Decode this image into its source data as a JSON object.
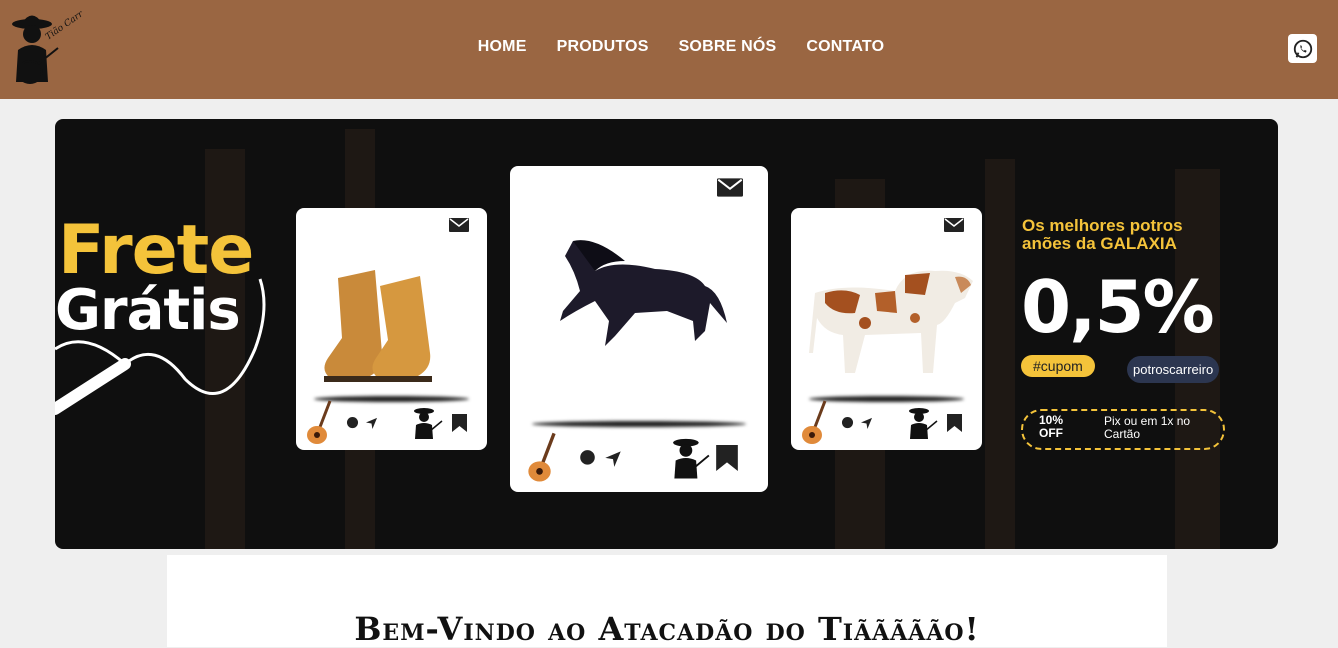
{
  "nav": {
    "items": [
      {
        "label": "HOME"
      },
      {
        "label": "PRODUTOS"
      },
      {
        "label": "SOBRE NÓS"
      },
      {
        "label": "CONTATO"
      }
    ]
  },
  "header": {
    "logo_text": "Tião Carreiro",
    "whatsapp_icon": "whatsapp-icon"
  },
  "banner": {
    "frete": "Frete",
    "gratis": "Grátis",
    "promo_title_1": "Os melhores potros",
    "promo_title_2": "anões da GALAXIA",
    "discount": "0,5%",
    "cupom": "#cupom",
    "code": "potroscarreiro",
    "off_1": "10%",
    "off_2": "OFF",
    "pix_1": "Pix ou em 1x no",
    "pix_2": "Cartão"
  },
  "cards": [
    {
      "product": "boots",
      "icons": [
        "mail-icon",
        "guitar-icon",
        "comment-icon",
        "send-icon",
        "logo-icon",
        "bookmark-icon"
      ]
    },
    {
      "product": "horse",
      "icons": [
        "mail-icon",
        "guitar-icon",
        "comment-icon",
        "send-icon",
        "logo-icon",
        "bookmark-icon"
      ]
    },
    {
      "product": "cow",
      "icons": [
        "mail-icon",
        "guitar-icon",
        "comment-icon",
        "send-icon",
        "logo-icon",
        "bookmark-icon"
      ]
    }
  ],
  "welcome": {
    "title": "Bem-Vindo ao Atacadão do Tiããããão!"
  },
  "colors": {
    "header": "#9a6642",
    "accent": "#f4c33a",
    "banner": "#0f0f0f"
  }
}
